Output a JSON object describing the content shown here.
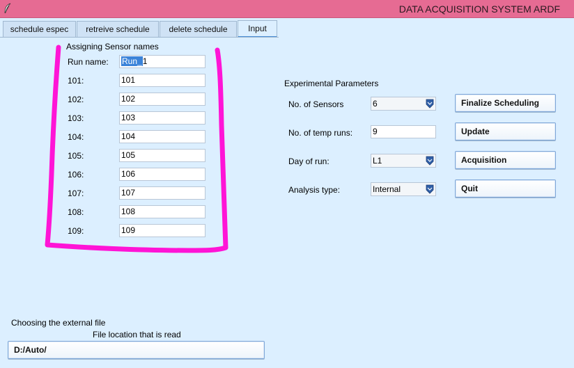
{
  "window": {
    "title": "DATA ACQUISITION SYSTEM ARDF",
    "icon": "feather-icon"
  },
  "tabs": [
    {
      "label": "schedule espec"
    },
    {
      "label": "retreive schedule"
    },
    {
      "label": "delete schedule"
    },
    {
      "label": "Input",
      "active": true
    }
  ],
  "sensors": {
    "title": "Assigning Sensor names",
    "run_label": "Run name:",
    "run_value_selected": "Run_",
    "run_value_rest": "1",
    "rows": [
      {
        "label": "101:",
        "value": "101"
      },
      {
        "label": "102:",
        "value": "102"
      },
      {
        "label": "103:",
        "value": "103"
      },
      {
        "label": "104:",
        "value": "104"
      },
      {
        "label": "105:",
        "value": "105"
      },
      {
        "label": "106:",
        "value": "106"
      },
      {
        "label": "107:",
        "value": "107"
      },
      {
        "label": "108:",
        "value": "108"
      },
      {
        "label": "109:",
        "value": "109"
      }
    ]
  },
  "params": {
    "title": "Experimental Parameters",
    "num_sensors_label": "No. of Sensors",
    "num_sensors_value": "6",
    "temp_runs_label": "No. of temp runs:",
    "temp_runs_value": "9",
    "day_label": "Day of run:",
    "day_value": "L1",
    "analysis_label": "Analysis type:",
    "analysis_value": "Internal"
  },
  "buttons": {
    "finalize": "Finalize Scheduling",
    "update": "Update",
    "acquisition": "Acquisition",
    "quit": "Quit"
  },
  "file": {
    "heading": "Choosing the external file",
    "location_label": "File location that is read",
    "path": "D:/Auto/"
  },
  "annotation_color": "#ff14d6"
}
